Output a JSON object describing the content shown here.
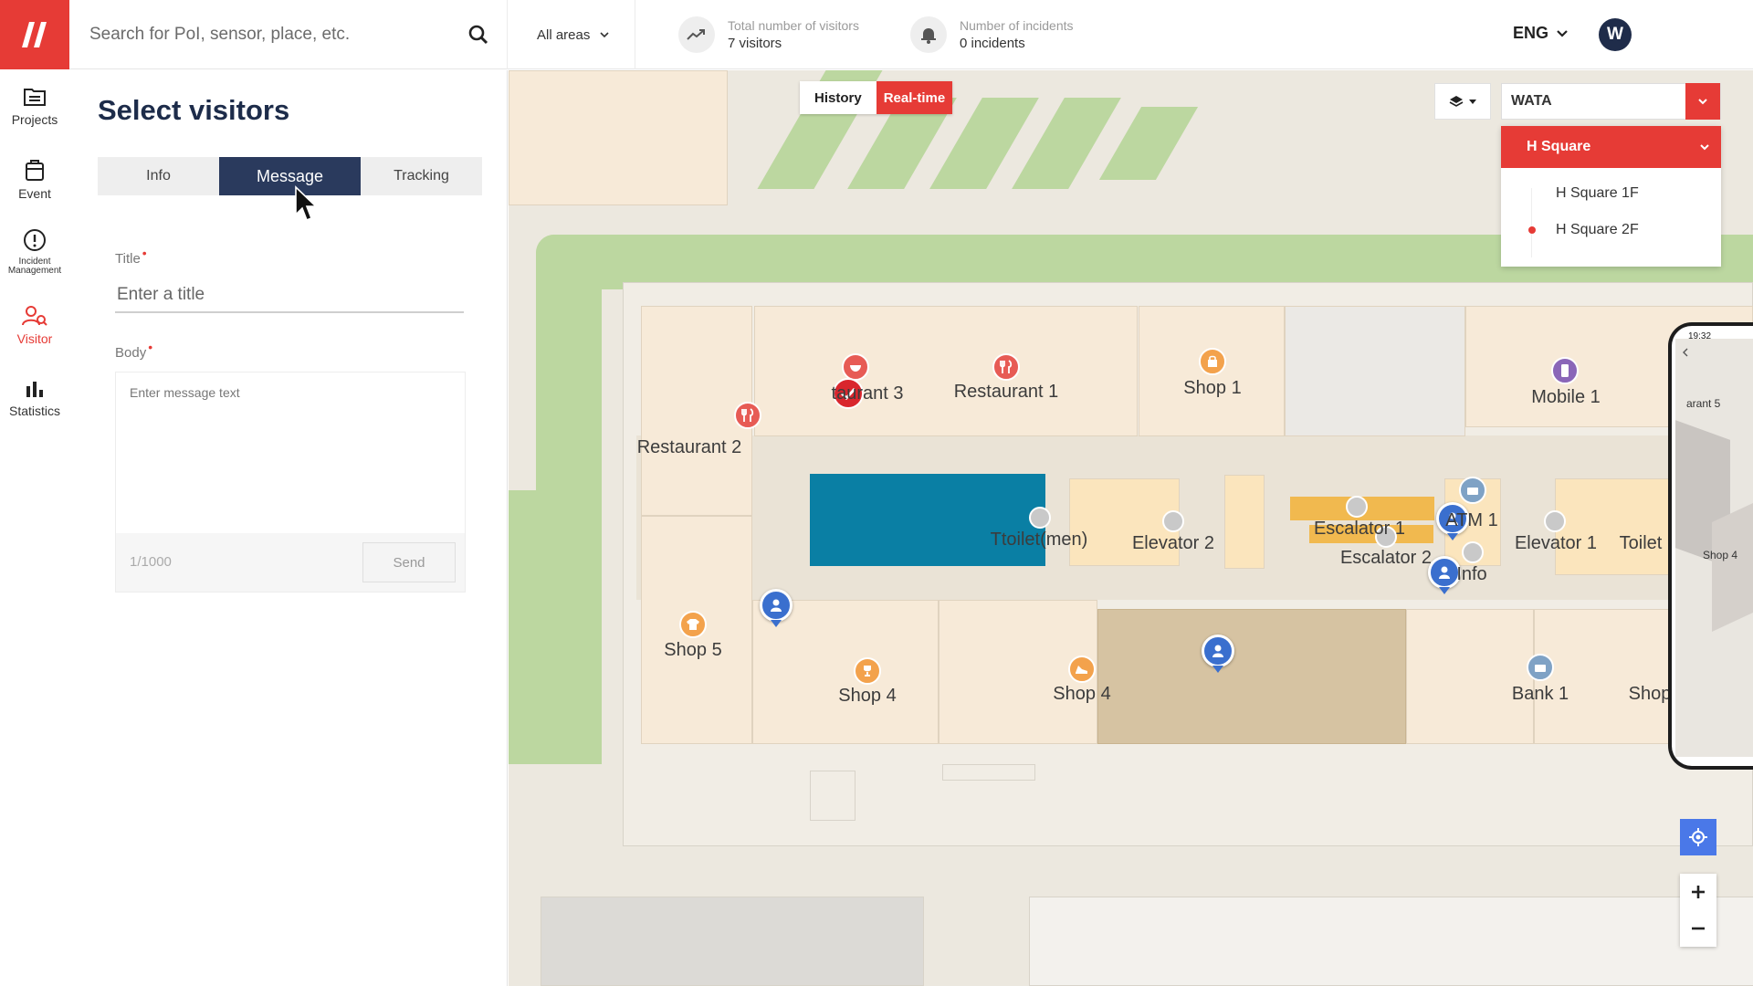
{
  "app": {
    "logo": "//",
    "accent": "#e63b36",
    "navy": "#1d2c4a"
  },
  "nav": {
    "items": [
      {
        "label": "Projects",
        "icon": "folder-icon"
      },
      {
        "label": "Event",
        "icon": "clipboard-icon"
      },
      {
        "label": "Incident Management",
        "icon": "alert-circle-icon"
      },
      {
        "label": "Visitor",
        "icon": "visitor-search-icon",
        "active": true
      },
      {
        "label": "Statistics",
        "icon": "bar-chart-icon"
      }
    ]
  },
  "header": {
    "search_placeholder": "Search for PoI, sensor, place, etc.",
    "area_filter": "All areas",
    "visitors": {
      "caption": "Total number of visitors",
      "value": "7 visitors"
    },
    "incidents": {
      "caption": "Number of incidents",
      "value": "0 incidents"
    },
    "language": "ENG",
    "user_initial": "W"
  },
  "panel": {
    "title": "Select visitors",
    "tabs": [
      {
        "label": "Info"
      },
      {
        "label": "Message",
        "active": true
      },
      {
        "label": "Tracking"
      }
    ],
    "form": {
      "title_label": "Title",
      "title_placeholder": "Enter a title",
      "body_label": "Body",
      "body_placeholder": "Enter message text",
      "counter": "1/1000",
      "send_label": "Send"
    }
  },
  "map": {
    "history_label": "History",
    "realtime_label": "Real-time",
    "site": "WATA",
    "building": "H Square",
    "floors": [
      {
        "label": "H Square 1F"
      },
      {
        "label": "H Square 2F",
        "selected": true
      }
    ],
    "places": [
      "taurant 3",
      "Restaurant 1",
      "Shop 1",
      "Mobile 1",
      "Restaurant 2",
      "Ttoilet(men)",
      "Elevator 2",
      "Escalator 1",
      "Escalator 2",
      "ATM 1",
      "Info",
      "Elevator 1",
      "Toilet",
      "Shop 5",
      "Shop 4",
      "Shop 4",
      "Bank 1",
      "Shop"
    ],
    "phone": {
      "time": "19:32",
      "place1": "arant 5",
      "place2": "Shop 4"
    }
  }
}
